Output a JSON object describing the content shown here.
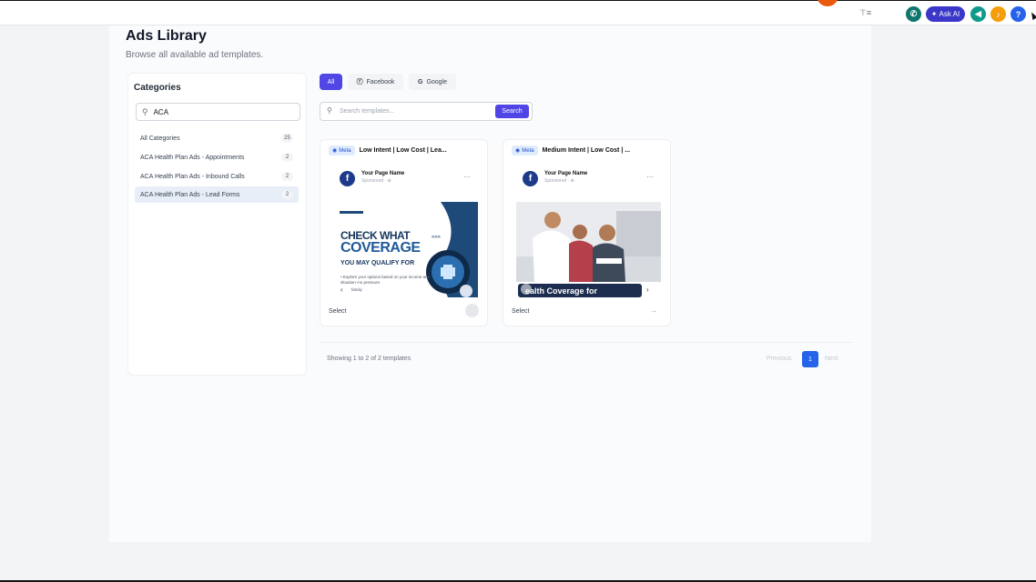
{
  "topbar": {
    "filter_icon": "filter-icon",
    "ask_ai_label": "Ask AI",
    "help_label": "?",
    "colors": {
      "phone": "#0f766e",
      "ask_ai": "#3b38c9",
      "megaphone": "#0e9a8a",
      "bell": "#f59e0b",
      "help": "#2563eb",
      "orange": "#ea580c"
    }
  },
  "page": {
    "title": "Ads Library",
    "subtitle": "Browse all available ad templates."
  },
  "sidebar": {
    "heading": "Categories",
    "search_value": "ACA",
    "items": [
      {
        "label": "All Categories",
        "count": "25"
      },
      {
        "label": "ACA Health Plan Ads - Appointments",
        "count": "2"
      },
      {
        "label": "ACA Health Plan Ads - Inbound Calls",
        "count": "2"
      },
      {
        "label": "ACA Health Plan Ads - Lead Forms",
        "count": "2"
      }
    ]
  },
  "filters": {
    "all": "All",
    "facebook": "Facebook",
    "google": "Google"
  },
  "search": {
    "placeholder": "Search templates...",
    "button": "Search"
  },
  "cards": [
    {
      "badge": "Meta",
      "title": "Low Intent | Low Cost | Lea...",
      "page_name": "Your Page Name",
      "sponsored": "Sponsored · ⊕",
      "ad_headline_1": "CHECK WHAT",
      "ad_headline_2": "COVERAGE",
      "ad_headline_3": "YOU MAY QUALIFY FOR",
      "ad_body": "• Explore your options based on your income and situation–no pressure.",
      "ad_family": "family",
      "select": "Select"
    },
    {
      "badge": "Meta",
      "title": "Medium Intent | Low Cost | ...",
      "page_name": "Your Page Name",
      "sponsored": "Sponsored · ⊕",
      "ad_banner": "ealth Coverage for",
      "select": "Select"
    }
  ],
  "pagination": {
    "showing": "Showing 1 to 2 of 2 templates",
    "previous": "Previous",
    "page": "1",
    "next": "Next"
  }
}
